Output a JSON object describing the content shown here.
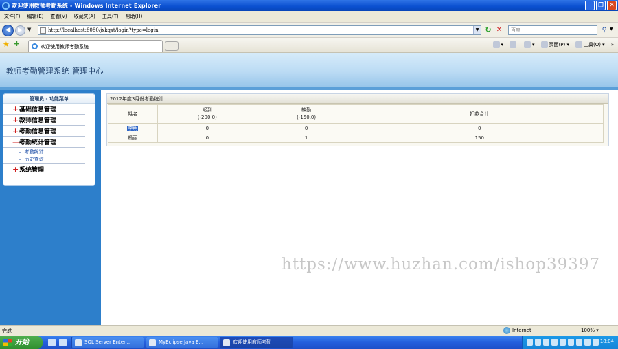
{
  "window": {
    "title": "欢迎使用教师考勤系统 - Windows Internet Explorer"
  },
  "menubar": {
    "items": [
      "文件(F)",
      "编辑(E)",
      "查看(V)",
      "收藏夹(A)",
      "工具(T)",
      "帮助(H)"
    ]
  },
  "address": {
    "url": "http://localhost:8080/jxkqxt/login?type=login",
    "search_placeholder": "百度"
  },
  "tabs": {
    "active_label": "欢迎使用教师考勤系统"
  },
  "commands": {
    "page_label": "页面(P)",
    "tools_label": "工具(O)"
  },
  "banner": {
    "title": "教师考勤管理系统 管理中心"
  },
  "sidebar": {
    "header": "管理员 - 功能菜单",
    "items": [
      {
        "label": "基础信息管理",
        "sign": "+"
      },
      {
        "label": "教师信息管理",
        "sign": "+"
      },
      {
        "label": "考勤信息管理",
        "sign": "+"
      },
      {
        "label": "考勤统计管理",
        "sign": "—"
      },
      {
        "label": "系统管理",
        "sign": "+"
      }
    ],
    "subitems": [
      {
        "label": "考勤统计"
      },
      {
        "label": "历史查询"
      }
    ]
  },
  "stats": {
    "caption": "2012年度3月份考勤统计",
    "headers": [
      {
        "title": "姓名",
        "sub": ""
      },
      {
        "title": "迟到",
        "sub": "(-200.0)"
      },
      {
        "title": "缺勤",
        "sub": "(-150.0)"
      },
      {
        "title": "扣款合计",
        "sub": ""
      }
    ],
    "rows": [
      {
        "name": "李明",
        "late": "0",
        "absent": "0",
        "total": "0"
      },
      {
        "name": "杨丽",
        "late": "0",
        "absent": "1",
        "total": "150"
      }
    ]
  },
  "watermark": "https://www.huzhan.com/ishop39397",
  "statusbar": {
    "text": "完成",
    "zone": "Internet",
    "zoom": "100%"
  },
  "taskbar": {
    "start_label": "开始",
    "tasks": [
      "SQL Server Enter...",
      "MyEclipse Java E...",
      "欢迎使用教师考勤"
    ],
    "clock": "18:04"
  },
  "colors": {
    "accent": "#2d7fcb",
    "banner": "#bcdcf4",
    "selection": "#3168c8",
    "plus_sign": "#d02020"
  }
}
